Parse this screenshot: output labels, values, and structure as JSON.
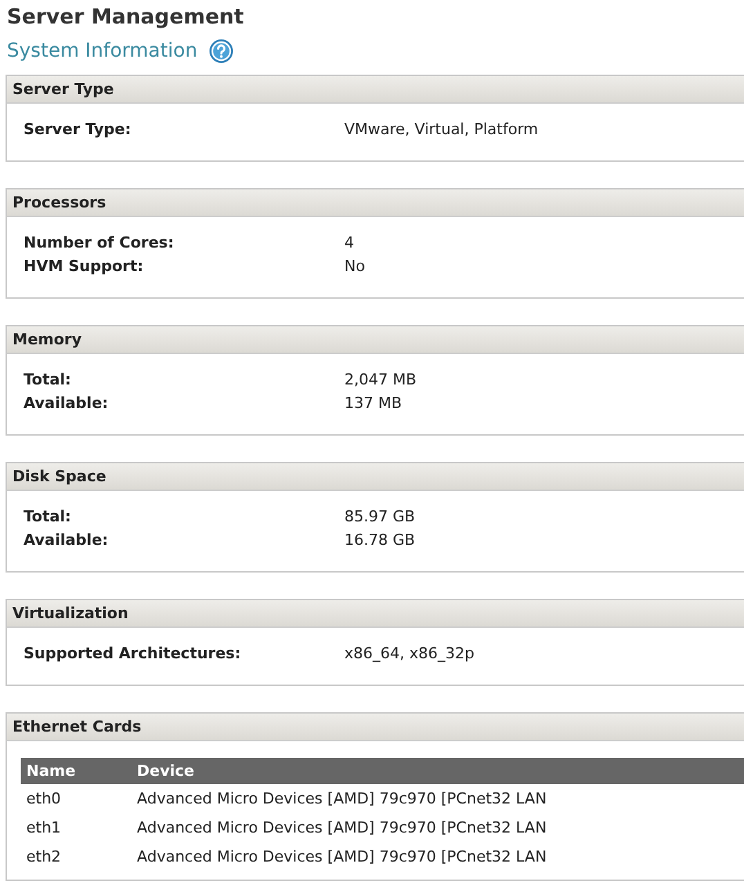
{
  "page": {
    "title": "Server Management",
    "subtitle": "System Information"
  },
  "sections": [
    {
      "kind": "pairs",
      "title": "Server Type",
      "rows": [
        {
          "label": "Server Type:",
          "value": "VMware, Virtual, Platform"
        }
      ]
    },
    {
      "kind": "pairs",
      "title": "Processors",
      "rows": [
        {
          "label": "Number of Cores:",
          "value": "4"
        },
        {
          "label": "HVM Support:",
          "value": "No"
        }
      ]
    },
    {
      "kind": "pairs",
      "title": "Memory",
      "rows": [
        {
          "label": "Total:",
          "value": "2,047 MB"
        },
        {
          "label": "Available:",
          "value": "137 MB"
        }
      ]
    },
    {
      "kind": "pairs",
      "title": "Disk Space",
      "rows": [
        {
          "label": "Total:",
          "value": "85.97 GB"
        },
        {
          "label": "Available:",
          "value": "16.78 GB"
        }
      ]
    },
    {
      "kind": "pairs",
      "title": "Virtualization",
      "rows": [
        {
          "label": "Supported Architectures:",
          "value": "x86_64, x86_32p"
        }
      ]
    },
    {
      "kind": "table",
      "title": "Ethernet Cards",
      "columns": [
        "Name",
        "Device"
      ],
      "rows": [
        [
          "eth0",
          "Advanced Micro Devices [AMD] 79c970 [PCnet32 LAN"
        ],
        [
          "eth1",
          "Advanced Micro Devices [AMD] 79c970 [PCnet32 LAN"
        ],
        [
          "eth2",
          "Advanced Micro Devices [AMD] 79c970 [PCnet32 LAN"
        ]
      ]
    }
  ]
}
